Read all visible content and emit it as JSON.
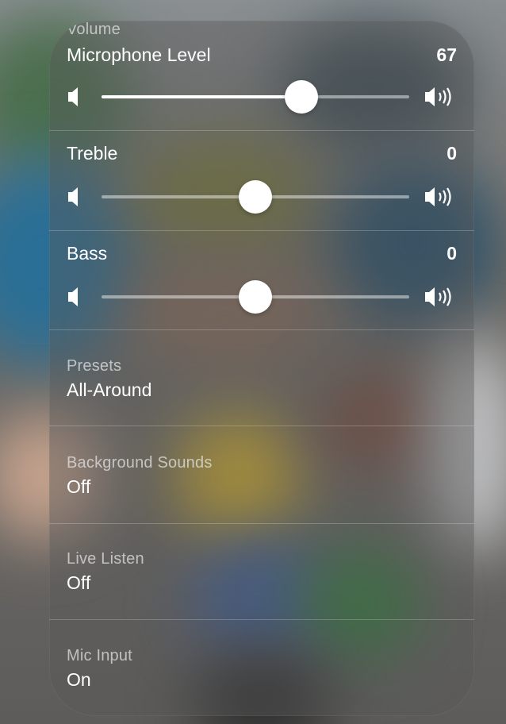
{
  "volume_header": "Volume",
  "sliders": [
    {
      "label": "Microphone Level",
      "value_text": "67",
      "level": 0.65,
      "filled": true
    },
    {
      "label": "Treble",
      "value_text": "0",
      "level": 0.5,
      "filled": false
    },
    {
      "label": "Bass",
      "value_text": "0",
      "level": 0.5,
      "filled": false
    }
  ],
  "settings": [
    {
      "caption": "Presets",
      "value": "All-Around"
    },
    {
      "caption": "Background Sounds",
      "value": "Off"
    },
    {
      "caption": "Live Listen",
      "value": "Off"
    },
    {
      "caption": "Mic Input",
      "value": "On"
    }
  ],
  "icons": {
    "min": "speaker-low-icon",
    "max": "speaker-high-icon"
  },
  "colors": {
    "text": "#ffffff",
    "track": "rgba(255,255,255,0.45)",
    "thumb": "#ffffff"
  }
}
